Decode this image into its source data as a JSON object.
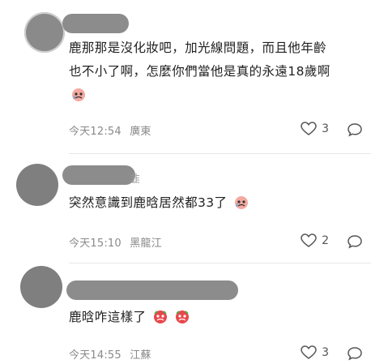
{
  "comments": [
    {
      "text_line1": "鹿那那是沒化妝吧，加光線問題，而且他年齡",
      "text_line2": "也不小了啊，怎麼你們當他是真的永遠18歲啊",
      "time": "今天12:54",
      "location": "廣東",
      "likes": "3",
      "emoji": "crying-face-emoji"
    },
    {
      "name_tail": "韭",
      "text": "突然意識到鹿晗居然都33了",
      "time": "今天15:10",
      "location": "黑龍江",
      "likes": "2",
      "emoji": "crying-face-emoji"
    },
    {
      "text": "鹿晗咋這樣了",
      "time": "今天14:55",
      "location": "江蘇",
      "likes": "3",
      "emoji": "crying-face-emoji"
    }
  ],
  "icons": {
    "like": "heart-outline-icon",
    "reply": "speech-bubble-icon"
  },
  "colors": {
    "redacted": "#8c8c8c",
    "meta_text": "#8a8a8a",
    "emoji_red": "#e8474c"
  }
}
